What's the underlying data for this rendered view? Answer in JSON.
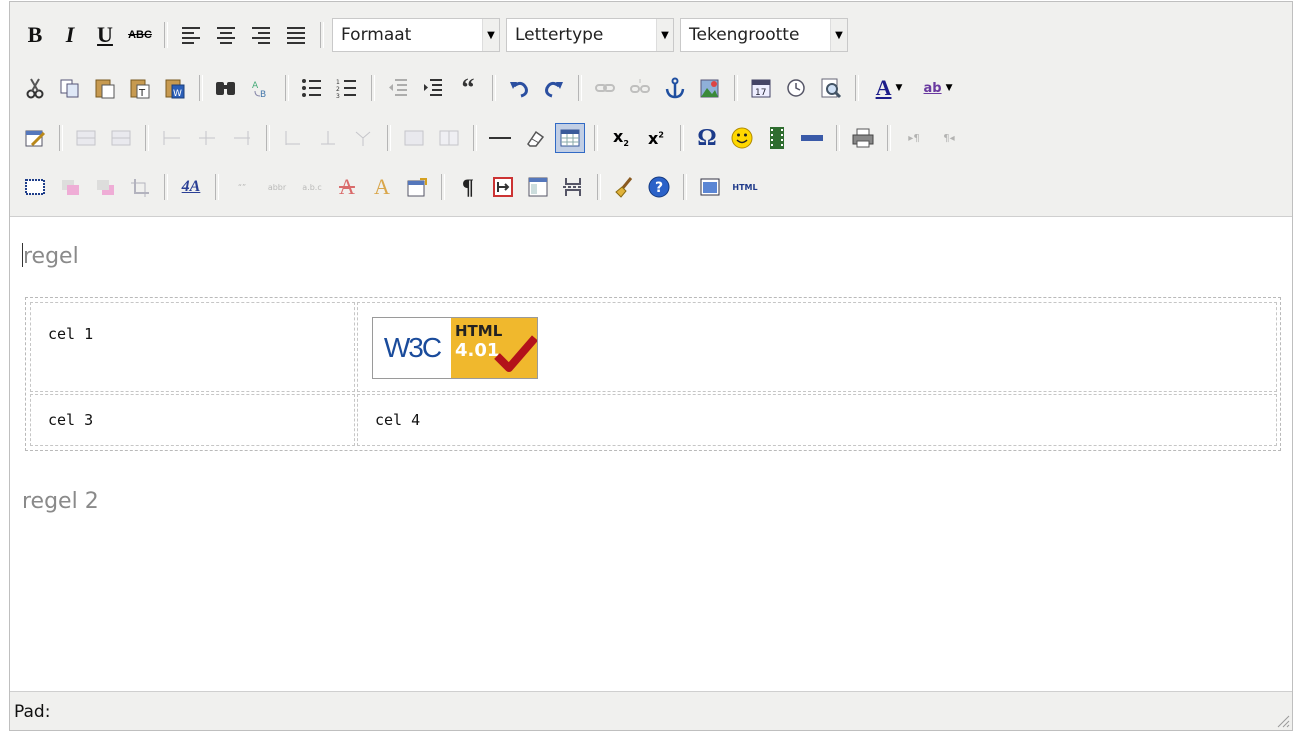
{
  "toolbar": {
    "bold_label": "B",
    "italic_label": "I",
    "underline_label": "U",
    "strike_label": "ABC",
    "format_select": "Formaat",
    "font_select": "Lettertype",
    "size_select": "Tekengrootte",
    "html_label": "HTML",
    "text_color_label": "A",
    "highlight_label": "ab",
    "font_style_label": "4A",
    "icons": [
      "cut-icon",
      "copy-icon",
      "paste-icon",
      "paste-text-icon",
      "paste-word-icon",
      "find-icon",
      "replace-icon",
      "bullet-list-icon",
      "numbered-list-icon",
      "outdent-icon",
      "indent-icon",
      "blockquote-icon",
      "undo-icon",
      "redo-icon",
      "link-icon",
      "unlink-icon",
      "anchor-icon",
      "image-icon",
      "insert-date-icon",
      "insert-time-icon",
      "preview-icon",
      "text-color-icon",
      "highlight-color-icon"
    ],
    "accent_color": "#316ac5"
  },
  "content": {
    "paragraph1": "regel",
    "paragraph2": "regel 2",
    "table": {
      "rows": [
        [
          "cel 1",
          ""
        ],
        [
          "cel 3",
          "cel 4"
        ]
      ]
    },
    "badge": {
      "brand": "W3C",
      "label": "HTML",
      "version": "4.01"
    }
  },
  "statusbar": {
    "path_label": "Pad:"
  }
}
